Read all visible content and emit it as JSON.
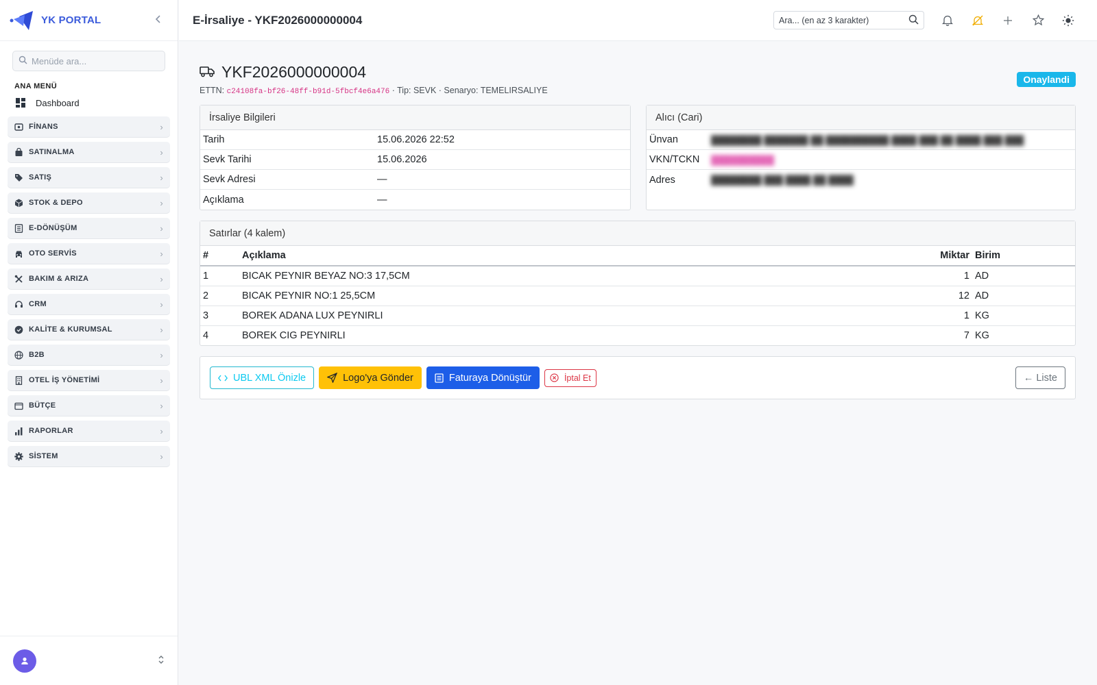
{
  "brand": {
    "name": "YK PORTAL"
  },
  "sidebar": {
    "search_placeholder": "Menüde ara...",
    "heading": "ANA MENÜ",
    "dashboard": "Dashboard",
    "items": [
      {
        "label": "FİNANS",
        "icon": "finance-icon"
      },
      {
        "label": "SATINALMA",
        "icon": "shopping-bag-icon"
      },
      {
        "label": "SATIŞ",
        "icon": "tag-icon"
      },
      {
        "label": "STOK & DEPO",
        "icon": "box-icon"
      },
      {
        "label": "E-DÖNÜŞÜM",
        "icon": "document-icon"
      },
      {
        "label": "OTO SERVİS",
        "icon": "car-icon"
      },
      {
        "label": "BAKIM & ARIZA",
        "icon": "tools-icon"
      },
      {
        "label": "CRM",
        "icon": "headset-icon"
      },
      {
        "label": "KALİTE & KURUMSAL",
        "icon": "quality-badge-icon"
      },
      {
        "label": "B2B",
        "icon": "globe-icon"
      },
      {
        "label": "OTEL İŞ YÖNETİMİ",
        "icon": "building-icon"
      },
      {
        "label": "BÜTÇE",
        "icon": "wallet-icon"
      },
      {
        "label": "RAPORLAR",
        "icon": "bar-chart-icon"
      },
      {
        "label": "SİSTEM",
        "icon": "gear-icon"
      }
    ]
  },
  "topbar": {
    "title": "E-İrsaliye - YKF2026000000004",
    "search_placeholder": "Ara... (en az 3 karakter)"
  },
  "doc": {
    "number": "YKF2026000000004",
    "ettn_label": "ETTN:",
    "ettn": "c24108fa-bf26-48ff-b91d-5fbcf4e6a476",
    "meta": "· Tip: SEVK · Senaryo: TEMELIRSALIYE",
    "status": "Onaylandi"
  },
  "irsaliye": {
    "header": "İrsaliye Bilgileri",
    "rows": [
      {
        "k": "Tarih",
        "v": "15.06.2026 22:52"
      },
      {
        "k": "Sevk Tarihi",
        "v": "15.06.2026"
      },
      {
        "k": "Sevk Adresi",
        "v": "—"
      },
      {
        "k": "Açıklama",
        "v": "—"
      }
    ]
  },
  "alici": {
    "header": "Alıcı (Cari)",
    "rows": [
      {
        "k": "Ünvan"
      },
      {
        "k": "VKN/TCKN"
      },
      {
        "k": "Adres"
      }
    ]
  },
  "lines": {
    "header": "Satırlar (4 kalem)",
    "columns": [
      "#",
      "Açıklama",
      "Miktar",
      "Birim"
    ],
    "rows": [
      {
        "no": "1",
        "desc": "BICAK PEYNIR BEYAZ NO:3 17,5CM",
        "qty": "1",
        "unit": "AD"
      },
      {
        "no": "2",
        "desc": "BICAK PEYNIR NO:1 25,5CM",
        "qty": "12",
        "unit": "AD"
      },
      {
        "no": "3",
        "desc": "BOREK ADANA LUX PEYNIRLI",
        "qty": "1",
        "unit": "KG"
      },
      {
        "no": "4",
        "desc": "BOREK CIG PEYNIRLI",
        "qty": "7",
        "unit": "KG"
      }
    ]
  },
  "actions": {
    "ubl": "UBL XML Önizle",
    "logo": "Logo'ya Gönder",
    "fatura": "Faturaya Dönüştür",
    "iptal": "İptal Et",
    "liste": "← Liste"
  },
  "colors": {
    "accent": "#3b5bdb",
    "status": "#1ab7ea",
    "warning": "#ffc107",
    "primary": "#1d5ee8"
  }
}
